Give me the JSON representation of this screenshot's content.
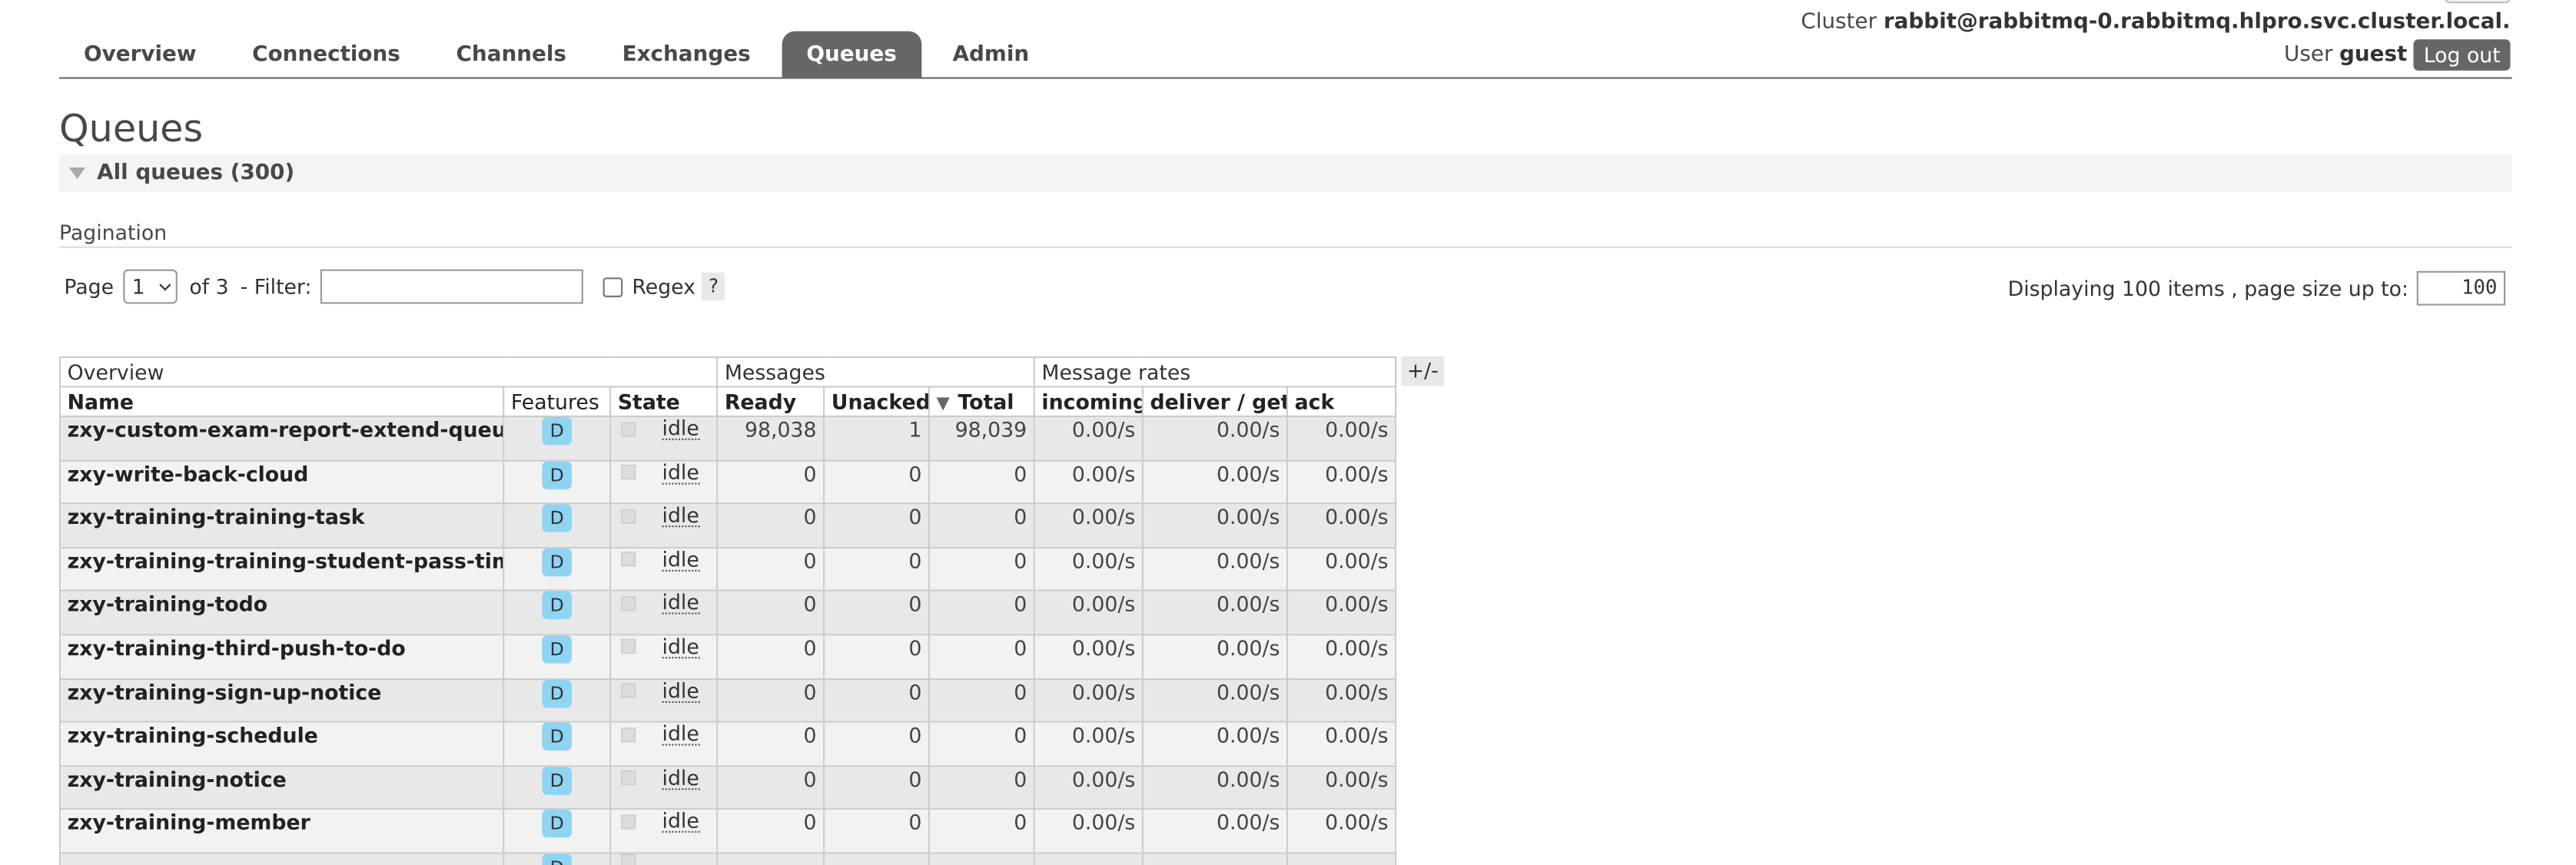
{
  "header": {
    "cluster_label": "Cluster",
    "cluster_name": "rabbit@rabbitmq-0.rabbitmq.hlpro.svc.cluster.local.",
    "user_label": "User",
    "user_name": "guest",
    "logout_label": "Log out"
  },
  "nav": {
    "tabs": [
      {
        "label": "Overview"
      },
      {
        "label": "Connections"
      },
      {
        "label": "Channels"
      },
      {
        "label": "Exchanges"
      },
      {
        "label": "Queues"
      },
      {
        "label": "Admin"
      }
    ],
    "active": "Queues"
  },
  "page": {
    "title": "Queues",
    "section_title": "All queues (300)"
  },
  "pagination": {
    "label": "Pagination",
    "page_label": "Page",
    "page_value": "1",
    "of_label": "of 3",
    "filter_label": "- Filter:",
    "filter_value": "",
    "regex_label": "Regex",
    "help_label": "?",
    "display_text": "Displaying 100 items , page size up to:",
    "page_size": "100"
  },
  "table": {
    "groups": [
      "Overview",
      "Messages",
      "Message rates"
    ],
    "headers": [
      "Name",
      "Features",
      "State",
      "Ready",
      "Unacked",
      "Total",
      "incoming",
      "deliver / get",
      "ack"
    ],
    "columns_toggle": "+/-",
    "rows": [
      {
        "name": "zxy-custom-exam-report-extend-queue",
        "feature": "D",
        "state": "idle",
        "ready": "98,038",
        "unacked": "1",
        "total": "98,039",
        "incoming": "0.00/s",
        "deliver": "0.00/s",
        "ack": "0.00/s"
      },
      {
        "name": "zxy-write-back-cloud",
        "feature": "D",
        "state": "idle",
        "ready": "0",
        "unacked": "0",
        "total": "0",
        "incoming": "0.00/s",
        "deliver": "0.00/s",
        "ack": "0.00/s"
      },
      {
        "name": "zxy-training-training-task",
        "feature": "D",
        "state": "idle",
        "ready": "0",
        "unacked": "0",
        "total": "0",
        "incoming": "0.00/s",
        "deliver": "0.00/s",
        "ack": "0.00/s"
      },
      {
        "name": "zxy-training-training-student-pass-time",
        "feature": "D",
        "state": "idle",
        "ready": "0",
        "unacked": "0",
        "total": "0",
        "incoming": "0.00/s",
        "deliver": "0.00/s",
        "ack": "0.00/s"
      },
      {
        "name": "zxy-training-todo",
        "feature": "D",
        "state": "idle",
        "ready": "0",
        "unacked": "0",
        "total": "0",
        "incoming": "0.00/s",
        "deliver": "0.00/s",
        "ack": "0.00/s"
      },
      {
        "name": "zxy-training-third-push-to-do",
        "feature": "D",
        "state": "idle",
        "ready": "0",
        "unacked": "0",
        "total": "0",
        "incoming": "0.00/s",
        "deliver": "0.00/s",
        "ack": "0.00/s"
      },
      {
        "name": "zxy-training-sign-up-notice",
        "feature": "D",
        "state": "idle",
        "ready": "0",
        "unacked": "0",
        "total": "0",
        "incoming": "0.00/s",
        "deliver": "0.00/s",
        "ack": "0.00/s"
      },
      {
        "name": "zxy-training-schedule",
        "feature": "D",
        "state": "idle",
        "ready": "0",
        "unacked": "0",
        "total": "0",
        "incoming": "0.00/s",
        "deliver": "0.00/s",
        "ack": "0.00/s"
      },
      {
        "name": "zxy-training-notice",
        "feature": "D",
        "state": "idle",
        "ready": "0",
        "unacked": "0",
        "total": "0",
        "incoming": "0.00/s",
        "deliver": "0.00/s",
        "ack": "0.00/s"
      },
      {
        "name": "zxy-training-member",
        "feature": "D",
        "state": "idle",
        "ready": "0",
        "unacked": "0",
        "total": "0",
        "incoming": "0.00/s",
        "deliver": "0.00/s",
        "ack": "0.00/s"
      },
      {
        "name": "",
        "feature": "D",
        "state": "",
        "ready": "",
        "unacked": "",
        "total": "",
        "incoming": "",
        "deliver": "",
        "ack": ""
      }
    ]
  }
}
